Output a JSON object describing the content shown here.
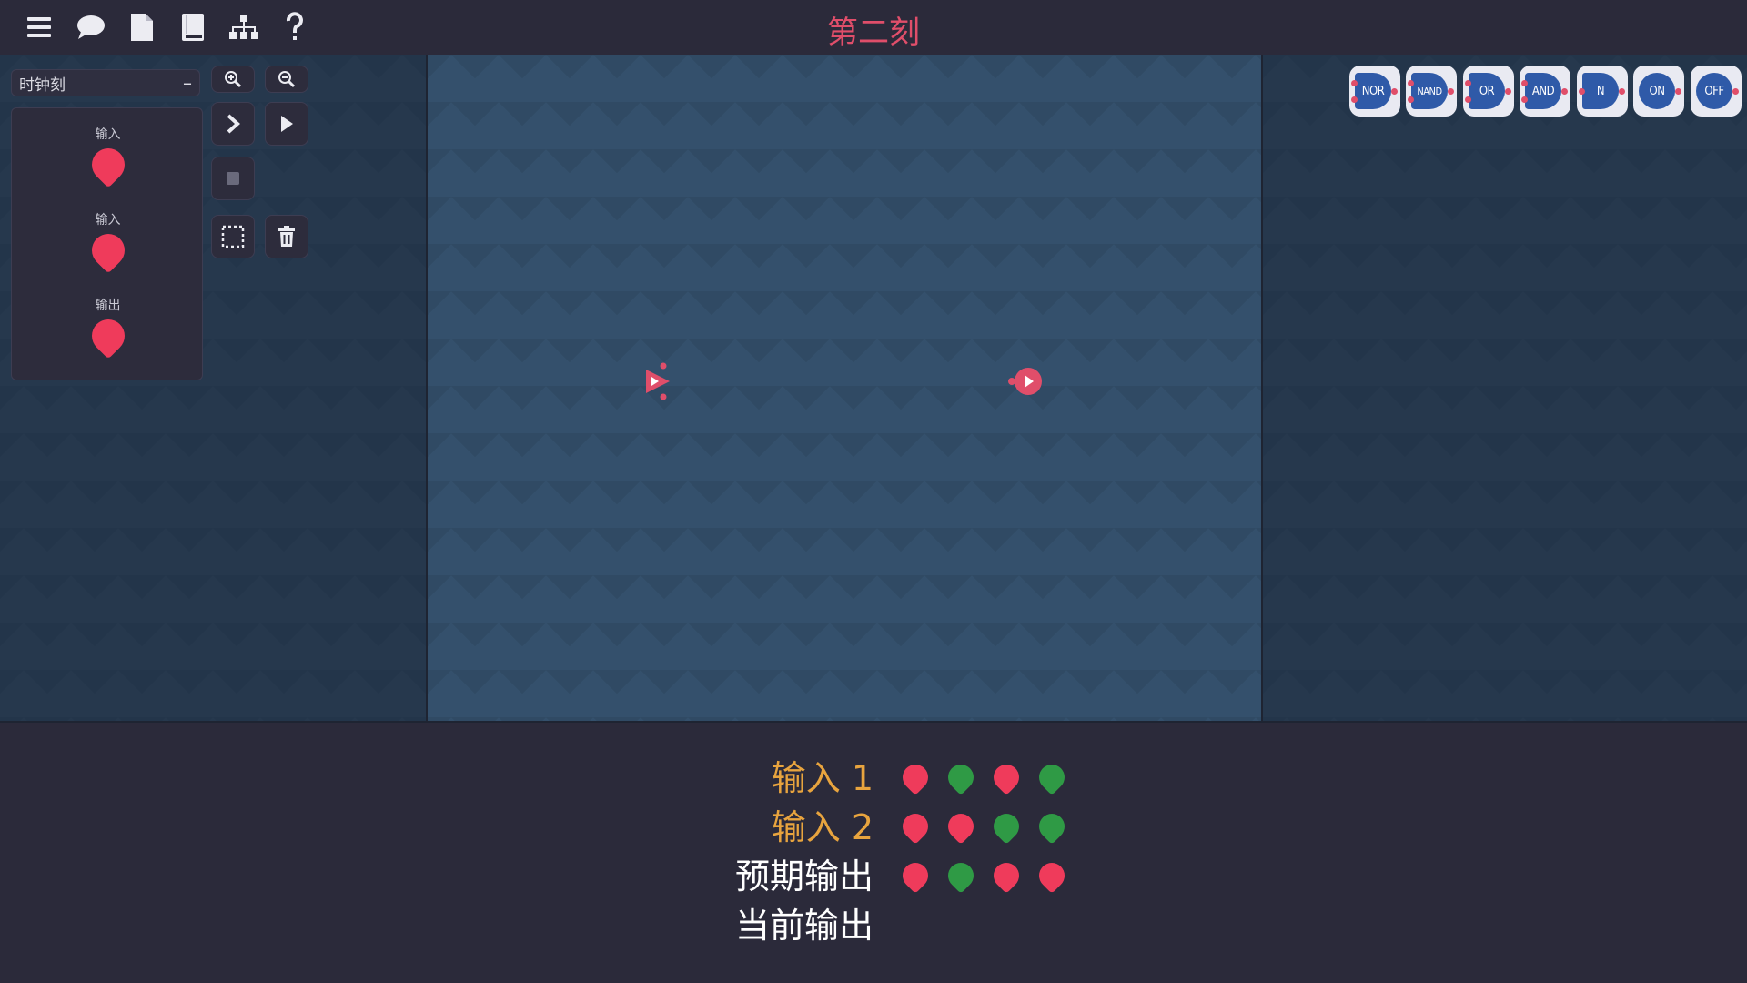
{
  "title": "第二刻",
  "level_select": {
    "value": "时钟刻",
    "toggle": "–"
  },
  "io_panel": [
    {
      "label": "输入",
      "state": "off"
    },
    {
      "label": "输入",
      "state": "off"
    },
    {
      "label": "输出",
      "state": "off"
    }
  ],
  "gates": [
    "NOR",
    "NAND",
    "OR",
    "AND",
    "N",
    "ON",
    "OFF"
  ],
  "truth_table": {
    "rows": [
      {
        "label": "输入 1",
        "values": [
          "off",
          "on",
          "off",
          "on"
        ]
      },
      {
        "label": "输入 2",
        "values": [
          "off",
          "off",
          "on",
          "on"
        ]
      },
      {
        "label": "预期输出",
        "values": [
          "off",
          "on",
          "off",
          "off"
        ]
      },
      {
        "label": "当前输出",
        "values": []
      }
    ]
  },
  "colors": {
    "on": "#2f9a45",
    "off": "#ef3b5b",
    "accent": "#e04e6a",
    "input_label": "#e8a43e"
  },
  "icons": [
    "menu-icon",
    "chat-icon",
    "file-icon",
    "book-icon",
    "hierarchy-icon",
    "help-icon",
    "zoom-in-icon",
    "zoom-out-icon",
    "step-icon",
    "play-icon",
    "stop-icon",
    "select-icon",
    "trash-icon"
  ]
}
